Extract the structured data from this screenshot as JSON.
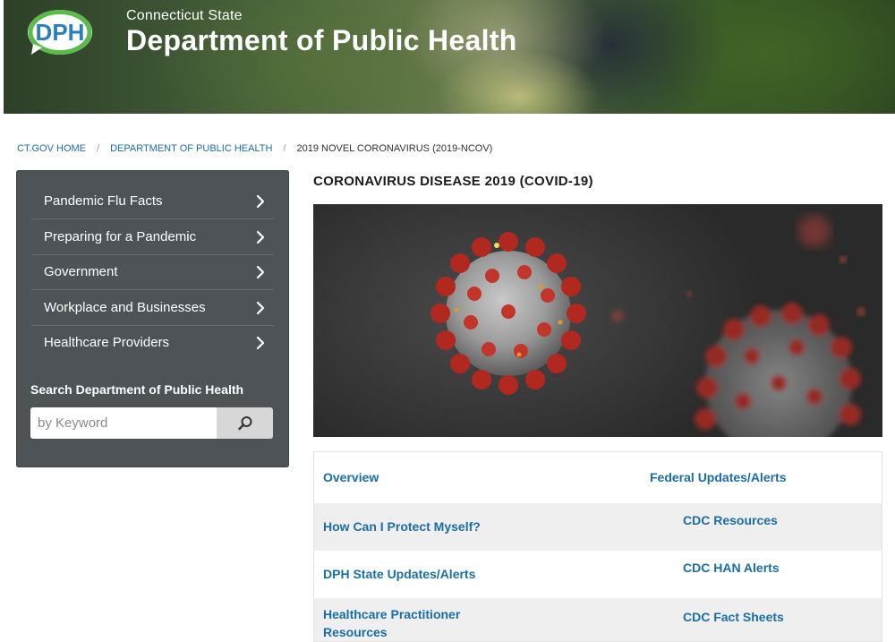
{
  "header": {
    "logo_text": "DPH",
    "subtitle": "Connecticut State",
    "title": "Department of Public Health"
  },
  "breadcrumb": [
    {
      "label": "CT.GOV HOME"
    },
    {
      "label": "DEPARTMENT OF PUBLIC HEALTH"
    },
    {
      "label": "2019 NOVEL CORONAVIRUS (2019-NCOV)"
    }
  ],
  "sidebar": {
    "items": [
      {
        "label": "Pandemic Flu Facts"
      },
      {
        "label": "Preparing for a Pandemic"
      },
      {
        "label": "Government"
      },
      {
        "label": "Workplace and Businesses"
      },
      {
        "label": "Healthcare Providers"
      }
    ],
    "search_title": "Search Department of Public Health",
    "search_placeholder": "by Keyword"
  },
  "main": {
    "title": "CORONAVIRUS DISEASE 2019 (COVID-19)",
    "links": {
      "overview": "Overview",
      "federal": "Federal Updates/Alerts",
      "protect": "How Can I Protect Myself?",
      "cdc_resources": "CDC Resources",
      "dph_updates": "DPH State Updates/Alerts",
      "cdc_han": "CDC HAN Alerts",
      "healthcare_line1": "Healthcare Practitioner",
      "healthcare_line2": "Resources",
      "cdc_fact": "CDC Fact Sheets"
    }
  },
  "colors": {
    "accent_link": "#1a6ea8",
    "sidebar_bg": "#4d5357",
    "logo_green": "#5aba4a",
    "logo_blue": "#2a7fc1"
  }
}
